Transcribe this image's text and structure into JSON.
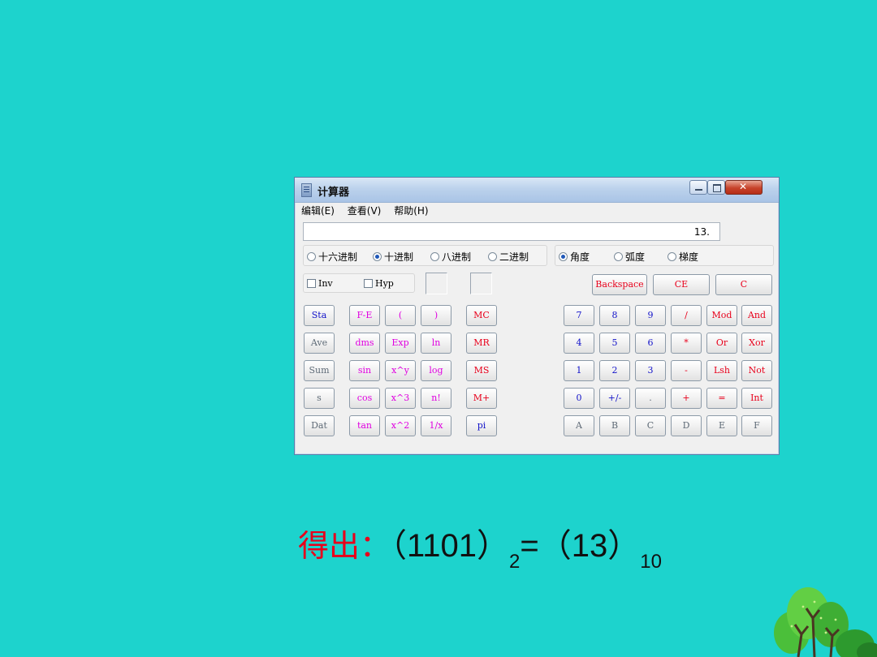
{
  "window": {
    "title": "计算器"
  },
  "menu": [
    "编辑(E)",
    "查看(V)",
    "帮助(H)"
  ],
  "display": {
    "value": "13."
  },
  "base_options": [
    {
      "label": "十六进制",
      "selected": false
    },
    {
      "label": "十进制",
      "selected": true
    },
    {
      "label": "八进制",
      "selected": false
    },
    {
      "label": "二进制",
      "selected": false
    }
  ],
  "angle_options": [
    {
      "label": "角度",
      "selected": true
    },
    {
      "label": "弧度",
      "selected": false
    },
    {
      "label": "梯度",
      "selected": false
    }
  ],
  "checkboxes": [
    {
      "label": "Inv",
      "checked": false
    },
    {
      "label": "Hyp",
      "checked": false
    }
  ],
  "top_buttons": [
    "Backspace",
    "CE",
    "C"
  ],
  "stat_buttons": [
    "Sta",
    "Ave",
    "Sum",
    "s",
    "Dat"
  ],
  "sci_buttons": [
    [
      "F-E",
      "(",
      ")"
    ],
    [
      "dms",
      "Exp",
      "ln"
    ],
    [
      "sin",
      "x^y",
      "log"
    ],
    [
      "cos",
      "x^3",
      "n!"
    ],
    [
      "tan",
      "x^2",
      "1/x"
    ]
  ],
  "mem_buttons": [
    "MC",
    "MR",
    "MS",
    "M+",
    "pi"
  ],
  "num_buttons": [
    [
      "7",
      "8",
      "9",
      "/",
      "Mod",
      "And"
    ],
    [
      "4",
      "5",
      "6",
      "*",
      "Or",
      "Xor"
    ],
    [
      "1",
      "2",
      "3",
      "-",
      "Lsh",
      "Not"
    ],
    [
      "0",
      "+/-",
      ".",
      "+",
      "=",
      "Int"
    ],
    [
      "A",
      "B",
      "C",
      "D",
      "E",
      "F"
    ]
  ],
  "result": {
    "lead": "得出：",
    "left_open": "（1101）",
    "left_base": "2",
    "equals": "=",
    "right_open": "（13）",
    "right_base": "10"
  },
  "colors": {
    "background": "#1dd3cd",
    "red": "#e8001b",
    "blue": "#1313c9",
    "magenta": "#e000e0"
  }
}
